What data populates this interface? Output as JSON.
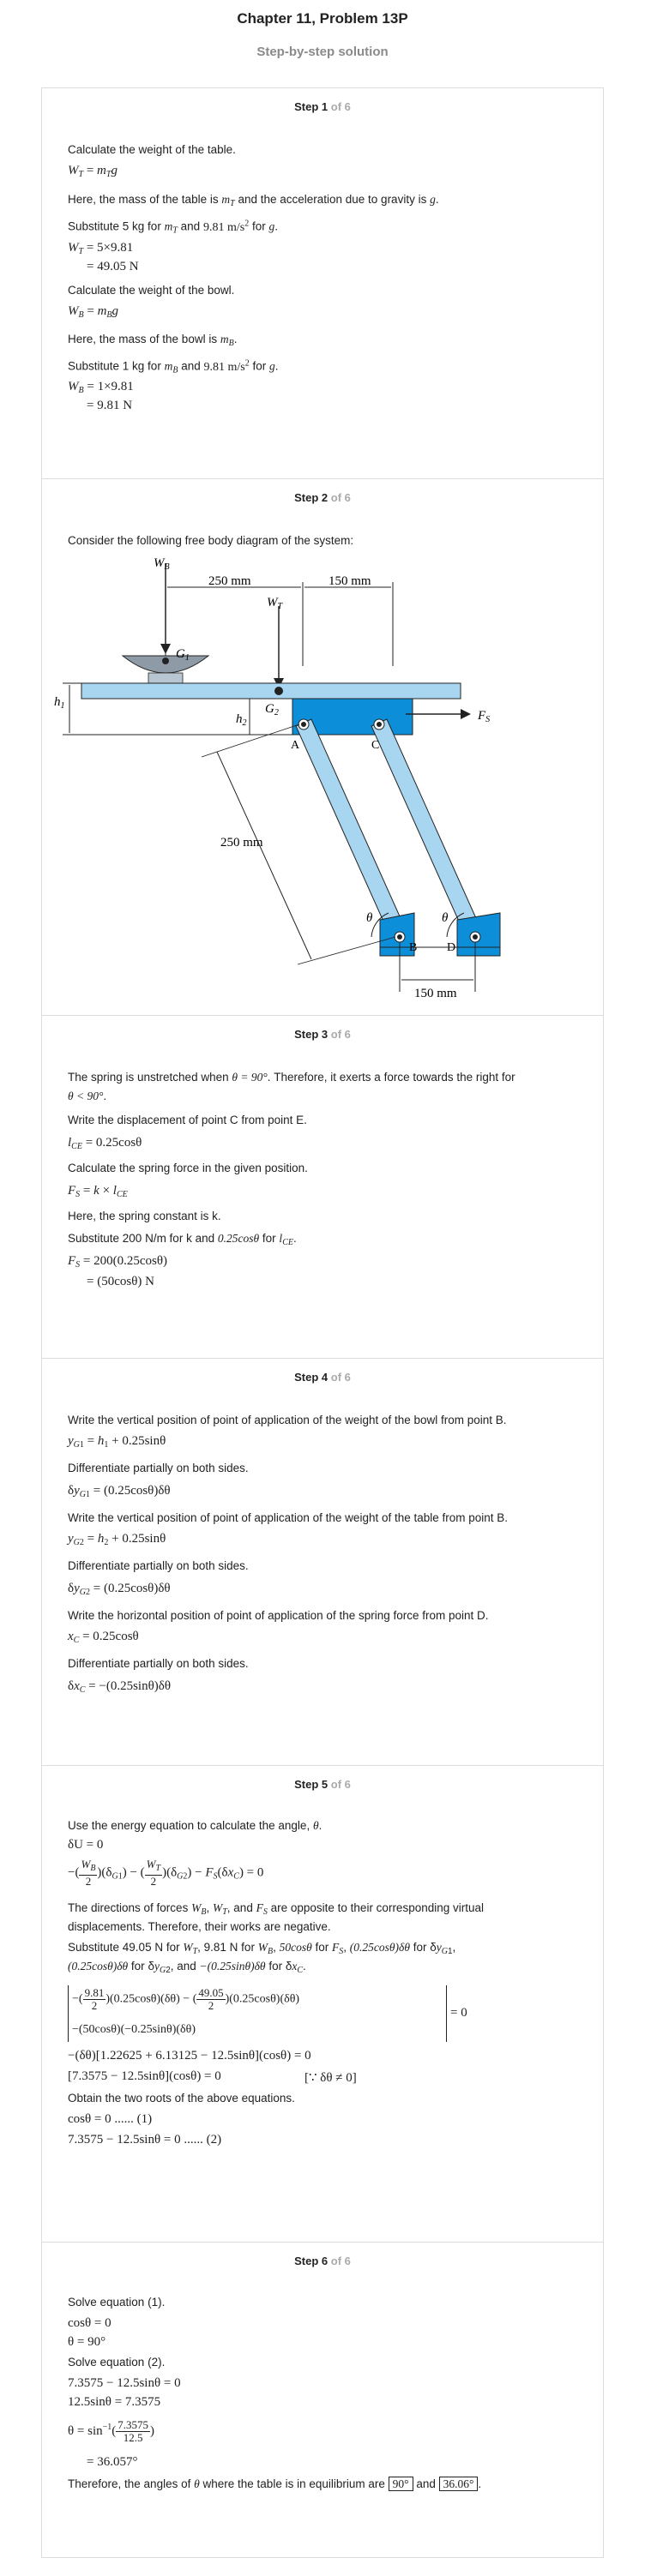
{
  "header": {
    "title": "Chapter 11, Problem 13P",
    "subtitle": "Step-by-step solution"
  },
  "steps": [
    {
      "label": "Step 1",
      "of": "of 6",
      "lines": {
        "l1": "Calculate the weight of the table.",
        "l3a": "Here, the mass of the table is",
        "l3b": "and the acceleration due to gravity is",
        "l4a": "Substitute 5 kg for",
        "l4b": "and",
        "l4c": "9.81 m/s",
        "l4d": "for",
        "l5": "W_T = 5×9.81",
        "l6": "= 49.05 N",
        "l7": "Calculate the weight of the bowl.",
        "l9": "Here, the mass of the bowl is",
        "l10a": "Substitute 1 kg for",
        "l10b": "and",
        "l10c": "9.81 m/s",
        "l10d": "for",
        "l11": "W_B = 1×9.81",
        "l12": "= 9.81 N"
      }
    },
    {
      "label": "Step 2",
      "of": "of 6",
      "lines": {
        "l1": "Consider the following free body diagram of the system:"
      },
      "diagram": {
        "dim_top1": "250 mm",
        "dim_top2": "150 mm",
        "dim_diag": "250 mm",
        "dim_bot": "150 mm",
        "labels": {
          "WB": "W",
          "WT": "W",
          "G1": "G",
          "G2": "G",
          "h1": "h",
          "h2": "h",
          "A": "A",
          "B": "B",
          "C": "C",
          "D": "D",
          "FS": "F",
          "theta": "θ"
        }
      }
    },
    {
      "label": "Step 3",
      "of": "of 6",
      "lines": {
        "l1a": "The spring is unstretched when",
        "l1b": "θ = 90°",
        "l1c": ". Therefore, it exerts a force towards the right for",
        "l2": "θ < 90°",
        "l3": "Write the displacement of point C from point E.",
        "l4": "= 0.25cosθ",
        "l5": "Calculate the spring force in the given position.",
        "l7": "Here, the spring constant is k.",
        "l8a": "Substitute 200 N/m for k and",
        "l8b": "0.25cosθ",
        "l8c": "for",
        "l9": "= 200(0.25cosθ)",
        "l10": "= (50cosθ) N"
      }
    },
    {
      "label": "Step 4",
      "of": "of 6",
      "lines": {
        "l1": "Write the vertical position of point of application of the weight of the bowl from point B.",
        "l2": "+ 0.25sinθ",
        "l3": "Differentiate partially on both sides.",
        "l4": "= (0.25cosθ)δθ",
        "l5": "Write the vertical position of point of application of the weight of the table from point B.",
        "l6": "+ 0.25sinθ",
        "l7": "Differentiate partially on both sides.",
        "l8": "= (0.25cosθ)δθ",
        "l9": "Write the horizontal position of point of application of the spring force from point D.",
        "l10": "= 0.25cosθ",
        "l11": "Differentiate partially on both sides.",
        "l12": "= −(0.25sinθ)δθ"
      }
    },
    {
      "label": "Step 5",
      "of": "of 6",
      "lines": {
        "l1": "Use the energy equation to calculate the angle,",
        "l2": "δU = 0",
        "l4a": "The directions of forces",
        "l4b": "and",
        "l4c": "are opposite to their corresponding virtual",
        "l5": "displacements. Therefore, their works are negative.",
        "l6a": "Substitute 49.05 N for",
        "l6b": ", 9.81 N for",
        "l6c": "for",
        "l6d": "for",
        "l7a": "for",
        "l7b": ", and",
        "l7c": "for",
        "l8": "= 0",
        "l9": "−(δθ)[1.22625 + 6.13125 − 12.5sinθ](cosθ) = 0",
        "l10": "[7.3575 − 12.5sinθ](cosθ) = 0",
        "l10b": "[∵ δθ ≠ 0]",
        "l11": "Obtain the two roots of the above equations.",
        "l12": "cosθ = 0 ...... (1)",
        "l13": "7.3575 − 12.5sinθ = 0 ...... (2)"
      }
    },
    {
      "label": "Step 6",
      "of": "of 6",
      "lines": {
        "l1": "Solve equation (1).",
        "l2": "cosθ = 0",
        "l3": "θ = 90°",
        "l4": "Solve equation (2).",
        "l5": "7.3575 − 12.5sinθ = 0",
        "l6": "12.5sinθ = 7.3575",
        "l7": "θ = sin",
        "l8": "= 36.057°",
        "l9a": "Therefore, the angles of",
        "l9b": "where the table is in equilibrium are",
        "l9c": "and",
        "ans1": "90°",
        "ans2": "36.06°"
      }
    }
  ]
}
